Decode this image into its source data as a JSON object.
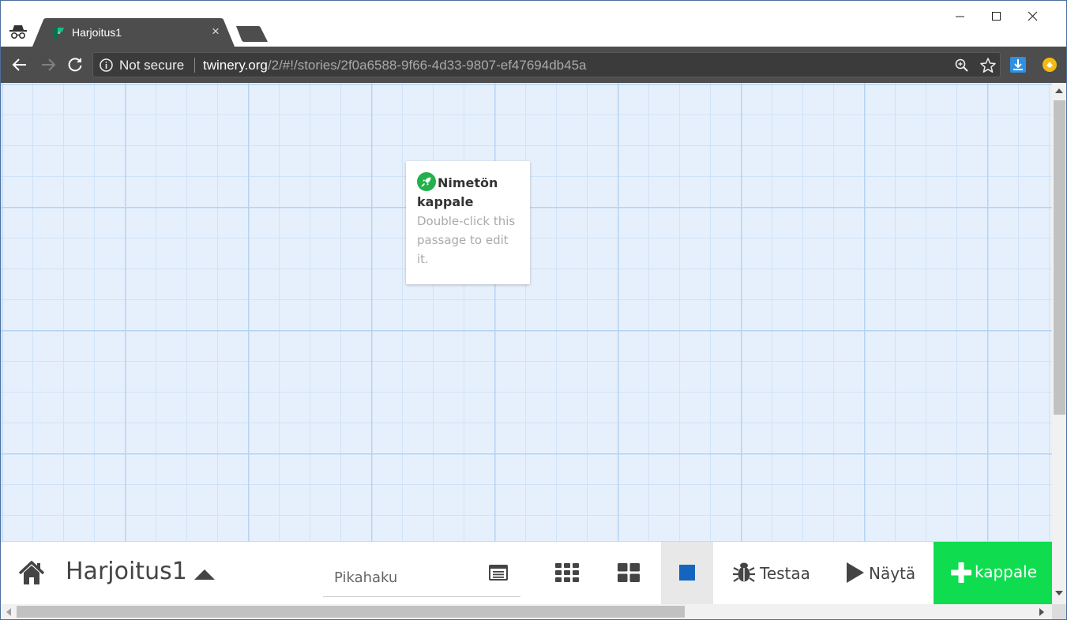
{
  "browser": {
    "tab_title": "Harjoitus1",
    "close_glyph": "×",
    "security_label": "Not secure",
    "url_host": "twinery.org",
    "url_path": "/2/#!/stories/2f0a6588-9f66-4d33-9807-ef47694db45a"
  },
  "passage": {
    "title": "Nimetön kappale",
    "excerpt": "Double-click this passage to edit it."
  },
  "story": {
    "name": "Harjoitus1"
  },
  "search": {
    "placeholder": "Pikahaku"
  },
  "buttons": {
    "test_label": "Testaa",
    "play_label": "Näytä",
    "add_label": "kappale"
  },
  "icons": {
    "tab_favicon": "twine-logo-icon",
    "incognito": "incognito-icon",
    "passage_start": "rocket-icon",
    "home": "home-icon",
    "story_menu": "caret-up-icon",
    "highlight": "highlight-passages-icon",
    "zoom_small": "grid-9-icon",
    "zoom_medium": "grid-4-icon",
    "zoom_large": "square-icon",
    "test": "bug-icon",
    "play": "play-icon",
    "add": "plus-icon"
  },
  "colors": {
    "toolbar": "#4d4d4d",
    "grid_background": "#e6f0fc",
    "add_button": "#10dc50",
    "start_icon": "#22b14c",
    "zoom_active": "#1565c0"
  }
}
